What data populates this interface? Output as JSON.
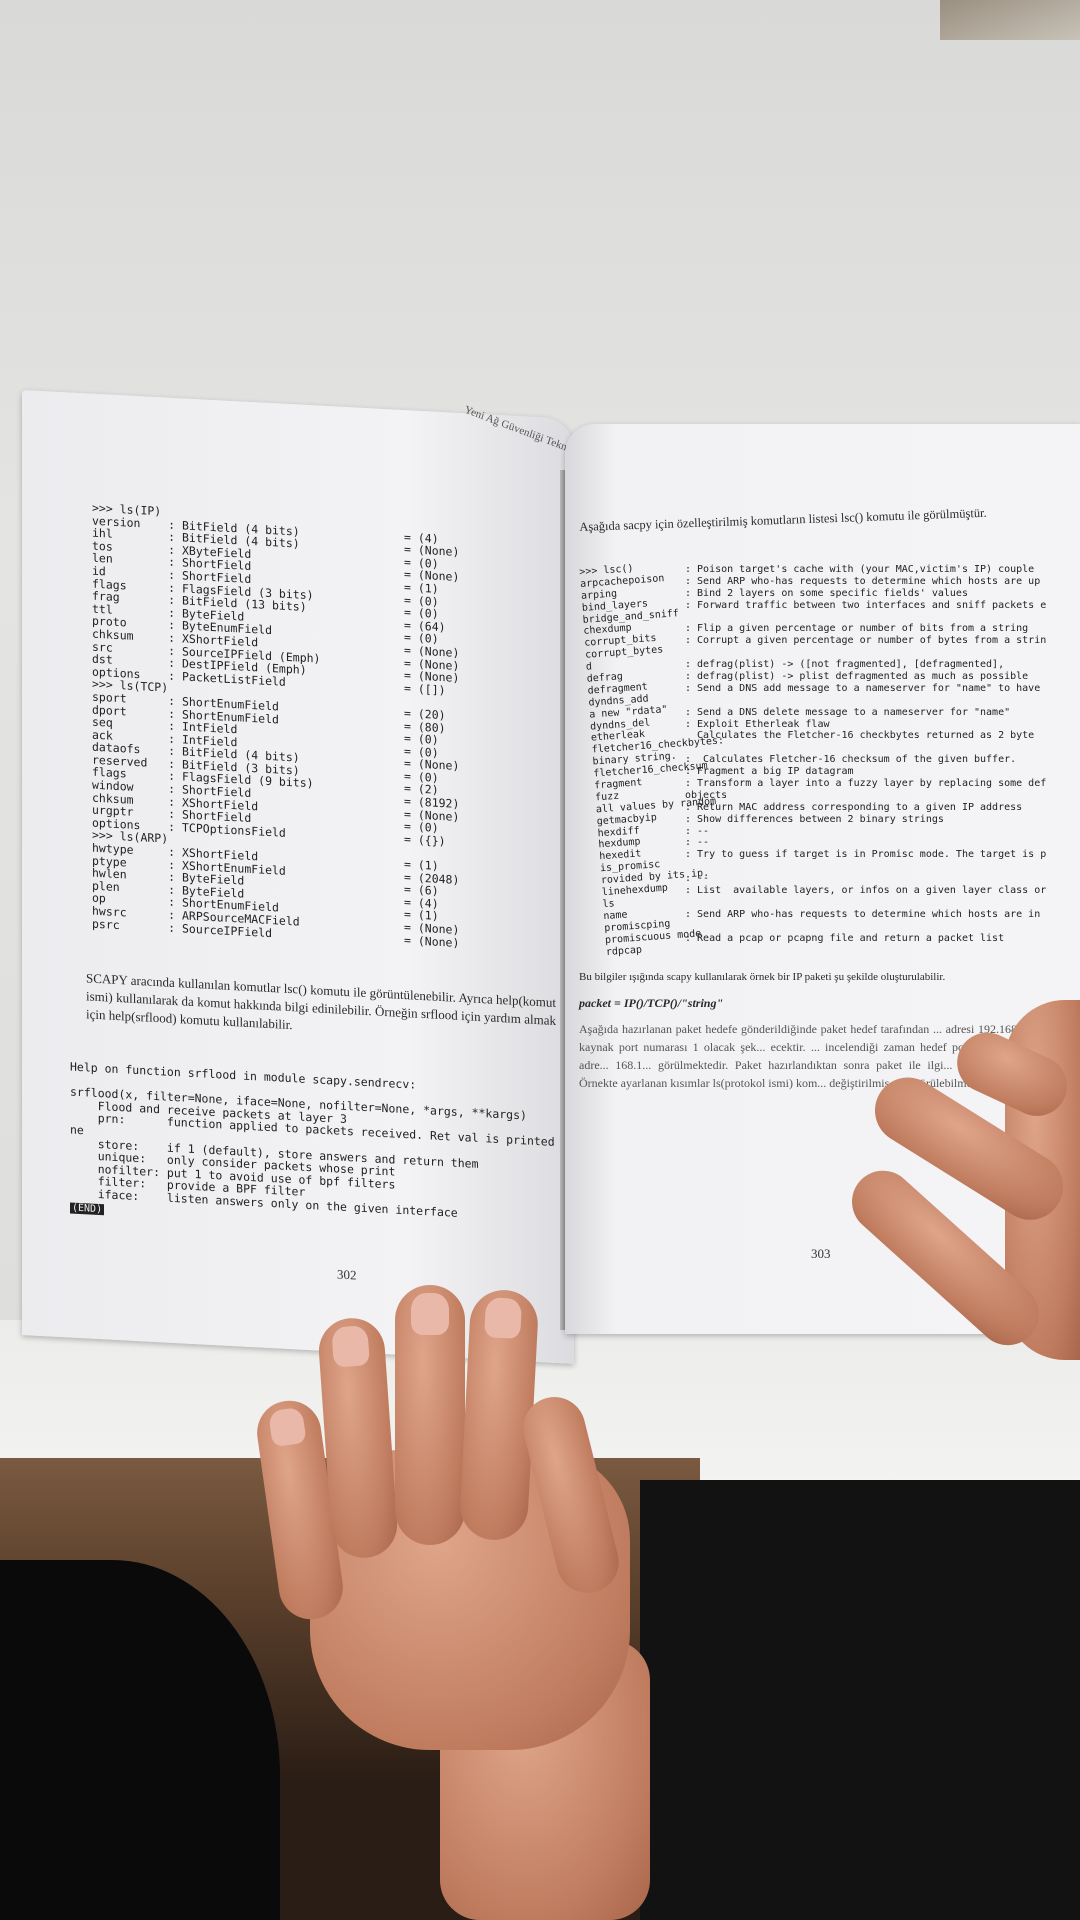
{
  "left_page": {
    "running_head": "Yeni Ağ Güvenliği Tekn...",
    "code_lines": [
      ">>> ls(IP)",
      "version    : BitField (4 bits)",
      "ihl        : BitField (4 bits)",
      "tos        : XByteField",
      "len        : ShortField",
      "id         : ShortField",
      "flags      : FlagsField (3 bits)",
      "frag       : BitField (13 bits)",
      "ttl        : ByteField",
      "proto      : ByteEnumField",
      "chksum     : XShortField",
      "src        : SourceIPField (Emph)",
      "dst        : DestIPField (Emph)",
      "options    : PacketListField",
      ">>> ls(TCP)",
      "sport      : ShortEnumField",
      "dport      : ShortEnumField",
      "seq        : IntField",
      "ack        : IntField",
      "dataofs    : BitField (4 bits)",
      "reserved   : BitField (3 bits)",
      "flags      : FlagsField (9 bits)",
      "window     : ShortField",
      "chksum     : XShortField",
      "urgptr     : ShortField",
      "options    : TCPOptionsField",
      ">>> ls(ARP)",
      "hwtype     : XShortField",
      "ptype      : XShortEnumField",
      "hwlen      : ByteField",
      "plen       : ByteField",
      "op         : ShortEnumField",
      "hwsrc      : ARPSourceMACField",
      "psrc       : SourceIPField"
    ],
    "default_values": [
      "",
      "= (4)",
      "= (None)",
      "= (0)",
      "= (None)",
      "= (1)",
      "= (0)",
      "= (0)",
      "= (64)",
      "= (0)",
      "= (None)",
      "= (None)",
      "= (None)",
      "= ([])",
      "",
      "= (20)",
      "= (80)",
      "= (0)",
      "= (0)",
      "= (None)",
      "= (0)",
      "= (2)",
      "= (8192)",
      "= (None)",
      "= (0)",
      "= ({})",
      "",
      "= (1)",
      "= (2048)",
      "= (6)",
      "= (4)",
      "= (1)",
      "= (None)",
      "= (None)"
    ],
    "paragraph": "SCAPY aracında kullanılan komutlar lsc() komutu ile görüntülenebilir. Ayrıca help(komut ismi) kullanılarak da komut hakkında bilgi edinilebilir.  Örneğin srflood için yardım almak için help(srflood) komutu kullanılabilir.",
    "help_lines": [
      "Help on function srflood in module scapy.sendrecv:",
      "",
      "srflood(x, filter=None, iface=None, nofilter=None, *args, **kargs)",
      "    Flood and receive packets at layer 3",
      "    prn:      function applied to packets received. Ret val is printed if not No",
      "ne",
      "    store:    if 1 (default), store answers and return them",
      "    unique:   only consider packets whose print",
      "    nofilter: put 1 to avoid use of bpf filters",
      "    filter:   provide a BPF filter",
      "    iface:    listen answers only on the given interface"
    ],
    "end_marker": "(END)",
    "page_number": "302"
  },
  "right_page": {
    "intro": "Aşağıda sacpy için özelleştirilmiş komutların listesi lsc() komutu ile görülmüştür.",
    "command_names": [
      ">>> lsc()",
      "arpcachepoison",
      "arping",
      "bind_layers",
      "bridge_and_sniff",
      "chexdump",
      "corrupt_bits",
      "corrupt_bytes",
      "d",
      "defrag",
      "defragment",
      "dyndns_add",
      "a new \"rdata\"",
      "dyndns_del",
      "etherleak",
      "fletcher16_checkbytes:",
      "binary string.",
      "fletcher16_checksum",
      "fragment",
      "fuzz",
      "all values by random",
      "getmacbyip",
      "hexdiff",
      "hexdump",
      "hexedit",
      "is_promisc",
      "rovided by its ip.",
      "linehexdump",
      "ls",
      "name",
      "promiscping",
      "promiscuous mode",
      "rdpcap"
    ],
    "command_descriptions": [
      ": Poison target's cache with (your MAC,victim's IP) couple",
      ": Send ARP who-has requests to determine which hosts are up",
      ": Bind 2 layers on some specific fields' values",
      ": Forward traffic between two interfaces and sniff packets e",
      "",
      ": Flip a given percentage or number of bits from a string",
      ": Corrupt a given percentage or number of bytes from a strin",
      "",
      ": defrag(plist) -> ([not fragmented], [defragmented],",
      ": defrag(plist) -> plist defragmented as much as possible",
      ": Send a DNS add message to a nameserver for \"name\" to have",
      "",
      ": Send a DNS delete message to a nameserver for \"name\"",
      ": Exploit Etherleak flaw",
      "  Calculates the Fletcher-16 checkbytes returned as 2 byte",
      "",
      ":  Calculates Fletcher-16 checksum of the given buffer.",
      ": Fragment a big IP datagram",
      ": Transform a layer into a fuzzy layer by replacing some def",
      "objects",
      ": Return MAC address corresponding to a given IP address",
      ": Show differences between 2 binary strings",
      ": --",
      ": --",
      ": Try to guess if target is in Promisc mode. The target is p",
      "",
      ": --",
      ": List  available layers, or infos on a given layer class or",
      "",
      ": Send ARP who-has requests to determine which hosts are in",
      "",
      ": Read a pcap or pcapng file and return a packet list"
    ],
    "paragraph1": "Bu bilgiler ışığında scapy kullanılarak örnek bir IP paketi şu şekilde oluşturulabilir.",
    "code_example": "packet = IP()/TCP()/\"string\"",
    "paragraph2": "Aşağıda hazırlanan paket hedefe gönderildiğinde paket hedef tarafından ... adresi 192.168.206.149 kaynak port numarası 1 olacak şek... ecektir. ... incelendiği zaman hedef portunun 80 hedef ip adre... 168.1... görülmektedir. Paket hazırlandıktan sonra paket ile ilgi... et) ko... görülebilir. Örnekte ayarlanan kısımlar ls(protokol ismi) kom... değiştirilmiş gibi görülebilmektedir.",
    "page_number": "303"
  }
}
